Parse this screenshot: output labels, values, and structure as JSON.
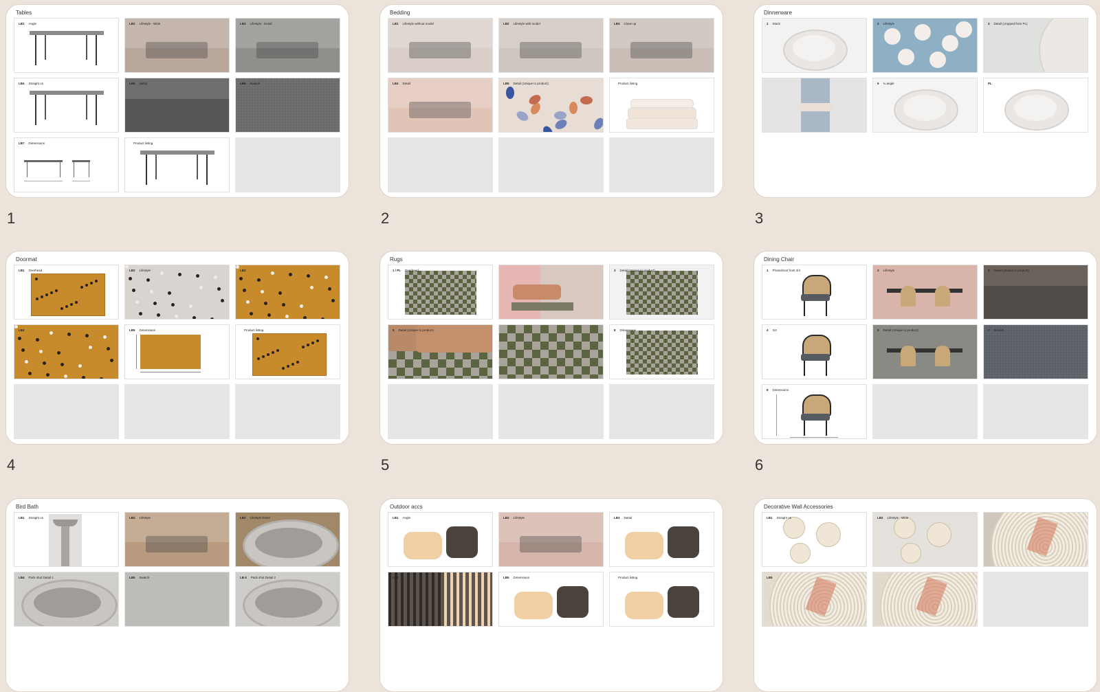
{
  "colors": {
    "background": "#ece3da",
    "card": "#ffffff",
    "empty_cell": "#e6e6e6",
    "text": "#333333"
  },
  "slides": [
    {
      "number": "1",
      "title": "Tables",
      "cells": [
        {
          "code": "LB1",
          "label": "Angle",
          "kind": "table",
          "bg": "#ffffff"
        },
        {
          "code": "LB2",
          "label": "Lifestyle - Wide",
          "kind": "photo-scene",
          "bg": "#b8a79a"
        },
        {
          "code": "LB3",
          "label": "Lifestyle - Detail",
          "kind": "photo-scene",
          "bg": "#8f8f8c"
        },
        {
          "code": "LB4",
          "label": "Straight on",
          "kind": "table",
          "bg": "#ffffff"
        },
        {
          "code": "LB5",
          "label": "Detail",
          "kind": "photo-dark",
          "bg": "#6e6e6e"
        },
        {
          "code": "LB6",
          "label": "Swatch",
          "kind": "swatch",
          "bg": "#6b6b6b"
        },
        {
          "code": "LB7",
          "label": "Dimensions",
          "kind": "dimensions",
          "bg": "#ffffff"
        },
        {
          "code": "",
          "label": "Product listing",
          "kind": "table",
          "bg": "#ffffff"
        },
        {
          "code": "",
          "label": "",
          "kind": "empty",
          "bg": "#e6e6e6"
        }
      ]
    },
    {
      "number": "2",
      "title": "Bedding",
      "cells": [
        {
          "code": "LB1",
          "label": "Lifestyle without model",
          "kind": "photo-scene",
          "bg": "#d9cfc8"
        },
        {
          "code": "LB2",
          "label": "Lifestyle with model",
          "kind": "photo-scene",
          "bg": "#cfc6bf"
        },
        {
          "code": "LB3",
          "label": "Close up",
          "kind": "photo-scene",
          "bg": "#c9bdb6"
        },
        {
          "code": "LB4",
          "label": "Detail",
          "kind": "photo-scene",
          "bg": "#e2c4b7"
        },
        {
          "code": "LB5",
          "label": "Detail (Unique to product)",
          "kind": "pattern",
          "bg": "#e8ddd5"
        },
        {
          "code": "",
          "label": "Product listing",
          "kind": "pillows",
          "bg": "#ffffff"
        },
        {
          "code": "",
          "label": "",
          "kind": "empty",
          "bg": "#e6e6e6"
        },
        {
          "code": "",
          "label": "",
          "kind": "empty",
          "bg": "#e6e6e6"
        },
        {
          "code": "",
          "label": "",
          "kind": "empty",
          "bg": "#e6e6e6"
        }
      ]
    },
    {
      "number": "3",
      "title": "Dinnerware",
      "cells": [
        {
          "code": "1",
          "label": "Stack",
          "kind": "plates",
          "bg": "#f2f2f2"
        },
        {
          "code": "2",
          "label": "Lifestyle",
          "kind": "plates-blue",
          "bg": "#8fb0c4"
        },
        {
          "code": "3",
          "label": "Detail (cropped from PL)",
          "kind": "plate-detail",
          "bg": "#dfe1df"
        },
        {
          "code": "",
          "label": "",
          "kind": "photo-person",
          "bg": "#e4e4e4"
        },
        {
          "code": "5",
          "label": "¾ angle",
          "kind": "plates",
          "bg": "#f4f4f4"
        },
        {
          "code": "PL",
          "label": "",
          "kind": "plates",
          "bg": "#ffffff"
        }
      ]
    },
    {
      "number": "4",
      "title": "Doormat",
      "cells": [
        {
          "code": "LB1",
          "label": "Overhead",
          "kind": "mat",
          "bg": "#ffffff"
        },
        {
          "code": "LB2",
          "label": "Lifestyle",
          "kind": "mat-scene",
          "bg": "#d8d5d1"
        },
        {
          "code": "LB3",
          "label": "",
          "kind": "mat-full",
          "bg": "#c88b2c"
        },
        {
          "code": "LB4",
          "label": "",
          "kind": "mat-full",
          "bg": "#c88b2c"
        },
        {
          "code": "LB5",
          "label": "Dimensions",
          "kind": "mat-dim",
          "bg": "#ffffff"
        },
        {
          "code": "",
          "label": "Product listing",
          "kind": "mat",
          "bg": "#ffffff"
        },
        {
          "code": "",
          "label": "",
          "kind": "empty",
          "bg": "#e6e6e6"
        },
        {
          "code": "",
          "label": "",
          "kind": "empty",
          "bg": "#e6e6e6"
        },
        {
          "code": "",
          "label": "",
          "kind": "empty",
          "bg": "#e6e6e6"
        }
      ]
    },
    {
      "number": "5",
      "title": "Rugs",
      "cells": [
        {
          "code": "1 / PL",
          "label": "Overhead",
          "kind": "rug",
          "bg": "#ffffff"
        },
        {
          "code": "",
          "label": "",
          "kind": "rug-scene",
          "bg": "#d8c8c0"
        },
        {
          "code": "3",
          "label": "Detail (Unique to product)",
          "kind": "rug-fold",
          "bg": "#f2f2f2"
        },
        {
          "code": "5",
          "label": "Detail (Unique to product)",
          "kind": "rug-sofa",
          "bg": "#b88a6a"
        },
        {
          "code": "",
          "label": "",
          "kind": "rug-full",
          "bg": "#6b7046"
        },
        {
          "code": "8",
          "label": "Dimensions",
          "kind": "rug-dim",
          "bg": "#ffffff"
        },
        {
          "code": "",
          "label": "",
          "kind": "empty",
          "bg": "#e6e6e6"
        },
        {
          "code": "",
          "label": "",
          "kind": "empty",
          "bg": "#e6e6e6"
        },
        {
          "code": "",
          "label": "",
          "kind": "empty",
          "bg": "#e6e6e6"
        }
      ]
    },
    {
      "number": "6",
      "title": "Dining Chair",
      "cells": [
        {
          "code": "1",
          "label": "Photoshoot front 3/4",
          "kind": "chair",
          "bg": "#ffffff"
        },
        {
          "code": "2",
          "label": "Lifestyle",
          "kind": "chair-scene",
          "bg": "#d9b4aa"
        },
        {
          "code": "3",
          "label": "Detail (Unique to product)",
          "kind": "photo-dark",
          "bg": "#6a625b"
        },
        {
          "code": "4",
          "label": "3/4",
          "kind": "chair",
          "bg": "#ffffff"
        },
        {
          "code": "5",
          "label": "Detail (Unique to product)",
          "kind": "chair-scene",
          "bg": "#8a8a84"
        },
        {
          "code": "7",
          "label": "Swatch",
          "kind": "swatch",
          "bg": "#5d6168"
        },
        {
          "code": "8",
          "label": "Dimensions",
          "kind": "chair-dim",
          "bg": "#ffffff"
        },
        {
          "code": "",
          "label": "",
          "kind": "empty",
          "bg": "#e6e6e6"
        },
        {
          "code": "",
          "label": "",
          "kind": "empty",
          "bg": "#e6e6e6"
        }
      ]
    },
    {
      "number": "",
      "title": "Bird Bath",
      "cells": [
        {
          "code": "LB1",
          "label": "Straight on",
          "kind": "birdbath",
          "bg": "#ffffff"
        },
        {
          "code": "LB2",
          "label": "Lifestyle",
          "kind": "photo-scene",
          "bg": "#b89a7e"
        },
        {
          "code": "LB3",
          "label": "Lifestyle Detail",
          "kind": "bowl",
          "bg": "#a08868"
        },
        {
          "code": "LB4",
          "label": "Pack shot Detail 1",
          "kind": "bowl-grey",
          "bg": "#d0cecb"
        },
        {
          "code": "LB5",
          "label": "Swatch",
          "kind": "swatch",
          "bg": "#bdbbb8"
        },
        {
          "code": "LB 6",
          "label": "Pack shot Detail 2",
          "kind": "bowl-grey",
          "bg": "#cfcdca"
        }
      ]
    },
    {
      "number": "",
      "title": "Outdoor accs",
      "cells": [
        {
          "code": "LB1",
          "label": "Angle",
          "kind": "pots",
          "bg": "#ffffff"
        },
        {
          "code": "LB2",
          "label": "Lifestyle",
          "kind": "photo-scene",
          "bg": "#d6b5aa"
        },
        {
          "code": "LB3",
          "label": "Detail",
          "kind": "pots",
          "bg": "#ffffff"
        },
        {
          "code": "LB4",
          "label": "",
          "kind": "ribbed",
          "bg": "#5d554d"
        },
        {
          "code": "LB5",
          "label": "Dimensions",
          "kind": "pots",
          "bg": "#ffffff"
        },
        {
          "code": "",
          "label": "Product listing",
          "kind": "pots",
          "bg": "#ffffff"
        }
      ]
    },
    {
      "number": "",
      "title": "Decorative Wall Accessories",
      "cells": [
        {
          "code": "LB1",
          "label": "Straight on",
          "kind": "baskets",
          "bg": "#ffffff"
        },
        {
          "code": "LB2",
          "label": "Lifestyle - Wide",
          "kind": "baskets",
          "bg": "#e4e1dc"
        },
        {
          "code": "",
          "label": "",
          "kind": "basket-detail",
          "bg": "#cfc7bc"
        },
        {
          "code": "LB5",
          "label": "",
          "kind": "weave",
          "bg": "#e2dccf"
        },
        {
          "code": "",
          "label": "",
          "kind": "weave",
          "bg": "#e0d9cc"
        },
        {
          "code": "",
          "label": "",
          "kind": "empty",
          "bg": "#e6e6e6"
        }
      ]
    }
  ]
}
